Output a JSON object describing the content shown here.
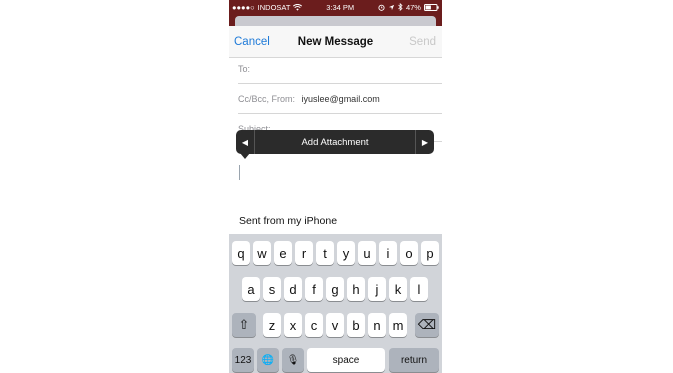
{
  "status_bar": {
    "signal": "●●●●○",
    "carrier": "INDOSAT",
    "wifi_icon": "wifi-icon",
    "time": "3:34 PM",
    "alarm_icon": "alarm-icon",
    "location_icon": "location-icon",
    "bluetooth_icon": "bluetooth-icon",
    "battery": "47%"
  },
  "nav": {
    "cancel": "Cancel",
    "title": "New Message",
    "send": "Send"
  },
  "fields": {
    "to_label": "To:",
    "ccbcc_label": "Cc/Bcc, From:",
    "from_value": "iyuslee@gmail.com",
    "subject_label": "Subject:"
  },
  "callout": {
    "prev_glyph": "◀",
    "label": "Add Attachment",
    "next_glyph": "▶"
  },
  "body": {
    "signature": "Sent from my iPhone"
  },
  "keyboard": {
    "row1": [
      "q",
      "w",
      "e",
      "r",
      "t",
      "y",
      "u",
      "i",
      "o",
      "p"
    ],
    "row2": [
      "a",
      "s",
      "d",
      "f",
      "g",
      "h",
      "j",
      "k",
      "l"
    ],
    "row3": [
      "z",
      "x",
      "c",
      "v",
      "b",
      "n",
      "m"
    ],
    "shift_glyph": "⇧",
    "delete_glyph": "⌫",
    "numbers": "123",
    "globe_glyph": "🌐",
    "mic_glyph": "🎙",
    "space": "space",
    "return": "return"
  },
  "colors": {
    "accent": "#1e7ad8",
    "statusbar": "#6b1d1d",
    "keyboard_bg": "#d1d4d9"
  }
}
